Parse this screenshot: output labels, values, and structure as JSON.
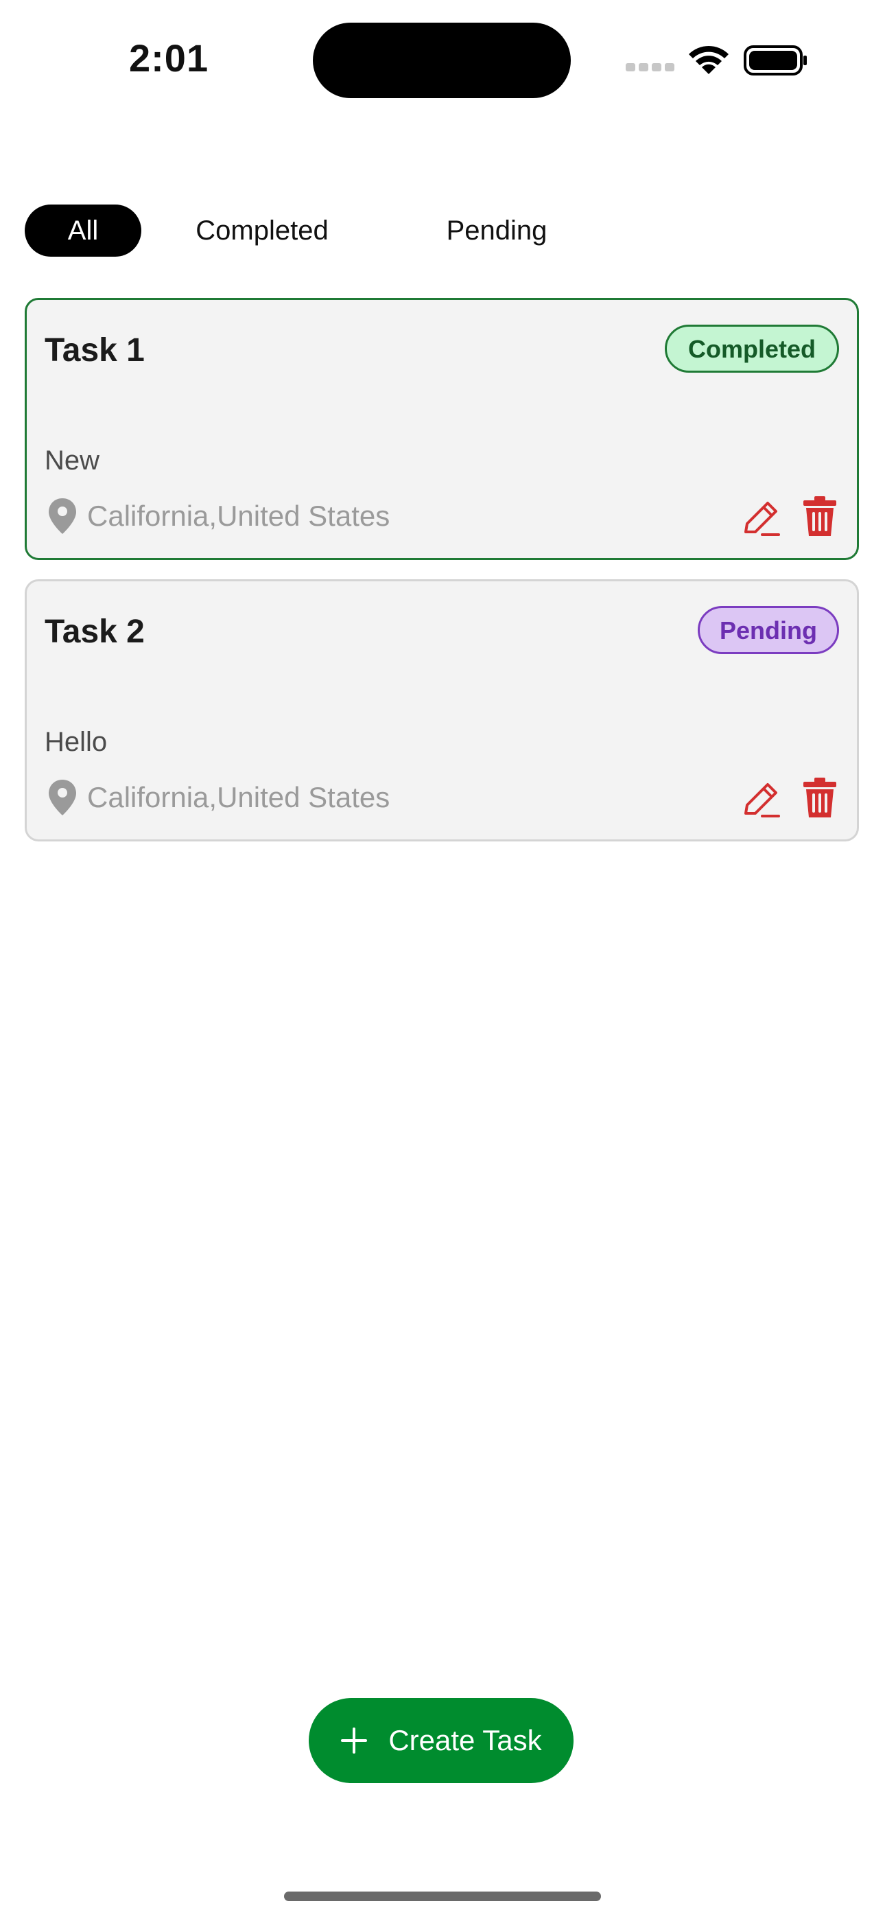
{
  "status_bar": {
    "time": "2:01"
  },
  "filters": {
    "all": "All",
    "completed": "Completed",
    "pending": "Pending",
    "active": "All"
  },
  "tasks": [
    {
      "title": "Task 1",
      "status": "Completed",
      "description": "New",
      "location": "California,United States"
    },
    {
      "title": "Task 2",
      "status": "Pending",
      "description": "Hello",
      "location": "California,United States"
    }
  ],
  "create_button": {
    "label": "Create Task"
  },
  "colors": {
    "accent_green": "#008c2e",
    "completed_border": "#1f7a35",
    "completed_bg": "#c4f5d2",
    "pending_border": "#7b3cc0",
    "pending_bg": "#dcc6f4",
    "action_red": "#d32f2f"
  },
  "icons": [
    "wifi-icon",
    "battery-icon",
    "signal-icon",
    "location-pin-icon",
    "edit-pencil-icon",
    "trash-icon",
    "plus-icon"
  ]
}
